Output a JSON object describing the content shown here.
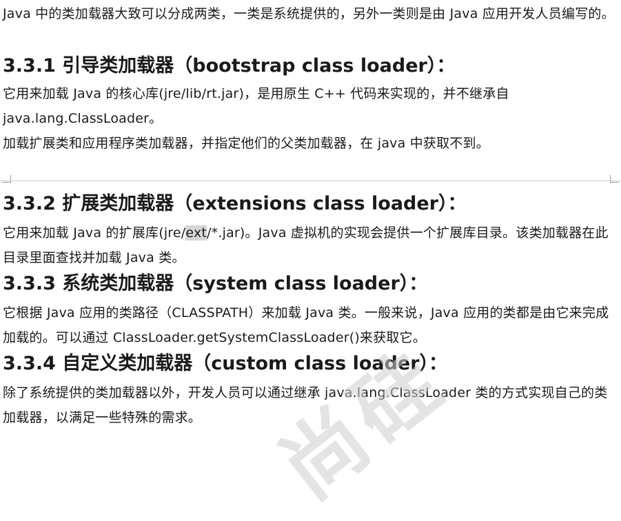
{
  "intro": "Java 中的类加载器大致可以分成两类，一类是系统提供的，另外一类则是由 Java 应用开发人员编写的。",
  "sections": [
    {
      "heading": "3.3.1 引导类加载器（bootstrap class loader）：",
      "paragraphs": [
        "它用来加载 Java 的核心库(jre/lib/rt.jar)，是用原生 C++ 代码来实现的，并不继承自 java.lang.ClassLoader。",
        "加载扩展类和应用程序类加载器，并指定他们的父类加载器，在 java 中获取不到。"
      ]
    },
    {
      "heading": "3.3.2 扩展类加载器（extensions class loader）：",
      "p_pre": "它用来加载 Java 的扩展库(jre/",
      "p_hl": "ext",
      "p_post": "/*.jar)。Java 虚拟机的实现会提供一个扩展库目录。该类加载器在此目录里面查找并加载 Java 类。"
    },
    {
      "heading": "3.3.3 系统类加载器（system class loader）：",
      "paragraphs": [
        "它根据 Java 应用的类路径（CLASSPATH）来加载 Java 类。一般来说，Java 应用的类都是由它来完成加载的。可以通过 ClassLoader.getSystemClassLoader()来获取它。"
      ]
    },
    {
      "heading": "3.3.4 自定义类加载器（custom class loader）：",
      "paragraphs": [
        "除了系统提供的类加载器以外，开发人员可以通过继承 java.lang.ClassLoader 类的方式实现自己的类加载器，以满足一些特殊的需求。"
      ]
    }
  ],
  "watermark": "尚硅谷"
}
